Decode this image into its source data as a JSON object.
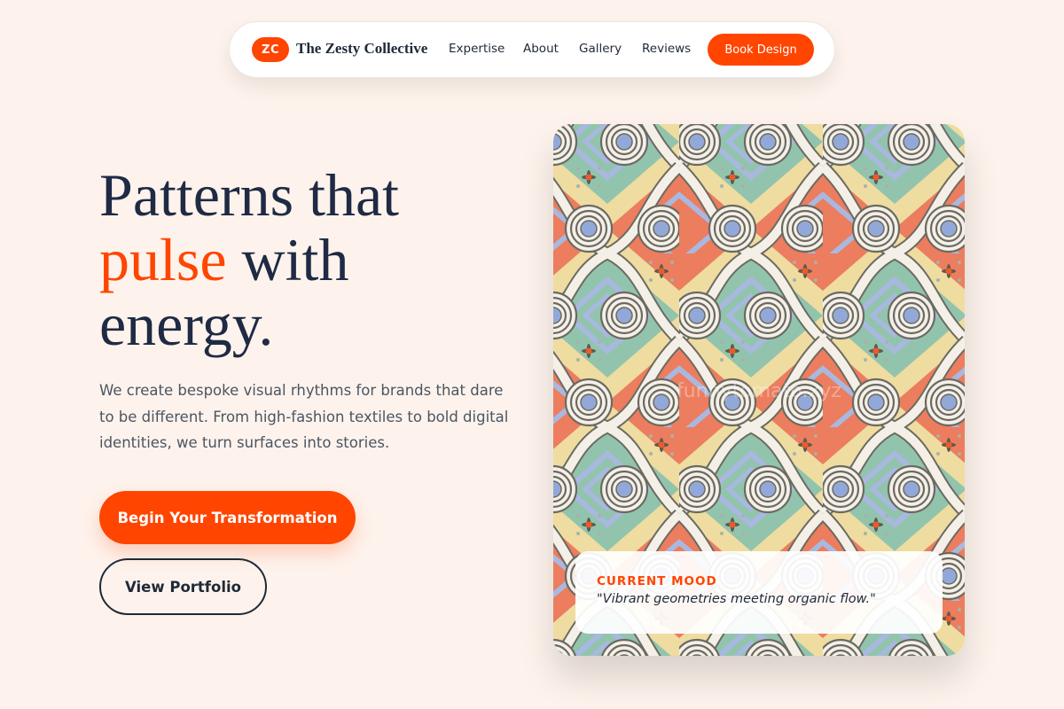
{
  "nav": {
    "logo_initials": "ZC",
    "brand_name": "The Zesty Collective",
    "links": [
      "Expertise",
      "About",
      "Gallery",
      "Reviews"
    ],
    "cta_label": "Book Design"
  },
  "hero": {
    "headline_line1": "Patterns that",
    "headline_accent": "pulse",
    "headline_line2_rest": " with",
    "headline_line3": "energy.",
    "description": "We create bespoke visual rhythms for brands that dare to be different. From high-fashion textiles to bold digital identities, we turn surfaces into stories.",
    "primary_button": "Begin Your Transformation",
    "secondary_button": "View Portfolio"
  },
  "showcase": {
    "watermark": "funnytomato.xyz",
    "mood_label": "CURRENT MOOD",
    "mood_quote": "\"Vibrant geometries meeting organic flow.\""
  },
  "colors": {
    "accent": "#ff4500",
    "background": "#fdf3ec",
    "text_dark": "#1f2a44"
  }
}
